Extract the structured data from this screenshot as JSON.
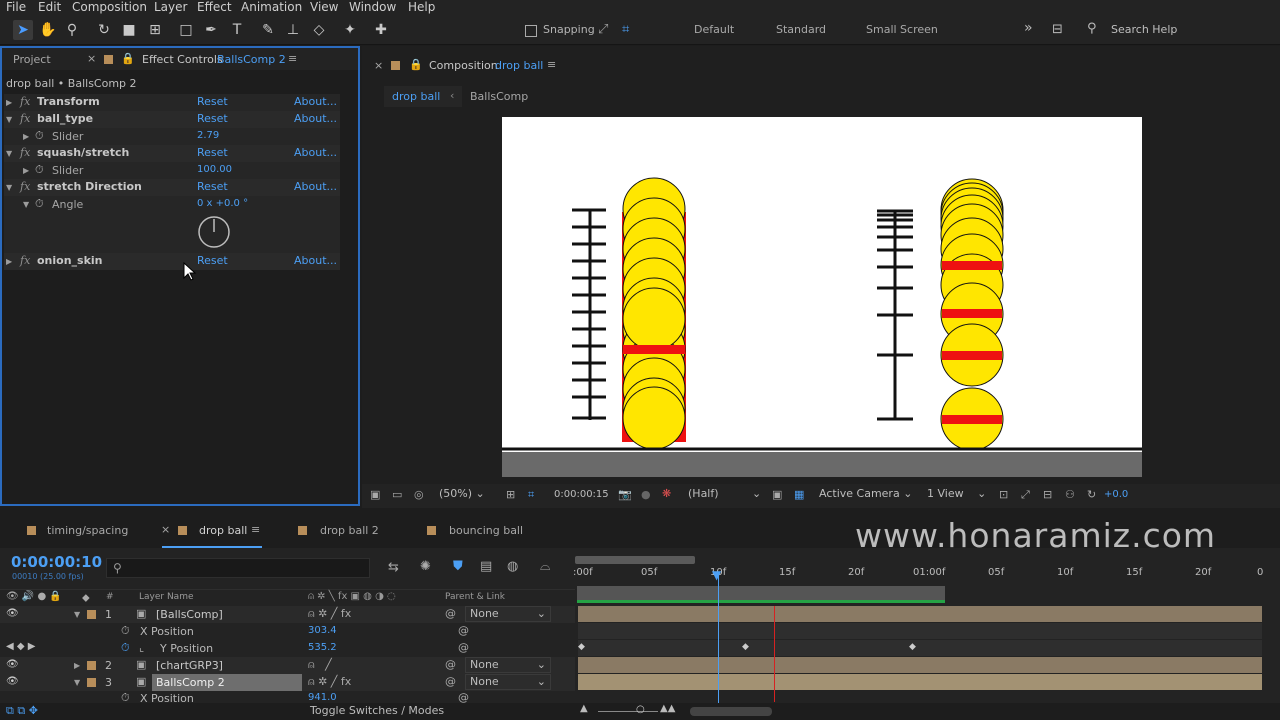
{
  "menu": [
    "File",
    "Edit",
    "Composition",
    "Layer",
    "Effect",
    "Animation",
    "View",
    "Window",
    "Help"
  ],
  "toolbar": {
    "snapping_label": "Snapping",
    "workspaces": [
      "Default",
      "Standard",
      "Small Screen"
    ],
    "search_placeholder": "Search Help"
  },
  "project_tab": "Project",
  "effect_controls": {
    "tab_label": "Effect Controls",
    "tab_target": "BallsComp 2",
    "breadcrumb": "drop ball • BallsComp 2",
    "reset_label": "Reset",
    "about_label": "About...",
    "effects": [
      {
        "name": "Transform"
      },
      {
        "name": "ball_type",
        "param": "Slider",
        "value": "2.79"
      },
      {
        "name": "squash/stretch",
        "param": "Slider",
        "value": "100.00"
      },
      {
        "name": "stretch Direction",
        "param": "Angle",
        "value": "0 x +0.0 °"
      },
      {
        "name": "onion_skin"
      }
    ]
  },
  "composition": {
    "tab_label": "Composition",
    "tab_target": "drop ball",
    "flow": [
      "drop ball",
      "BallsComp"
    ]
  },
  "viewer": {
    "zoom": "(50%)",
    "timecode": "0:00:00:15",
    "resolution": "(Half)",
    "camera": "Active Camera",
    "views": "1 View",
    "exposure": "+0.0"
  },
  "timeline": {
    "tabs": [
      "timing/spacing",
      "drop ball",
      "drop ball 2",
      "bouncing ball"
    ],
    "current_time": "0:00:00:10",
    "frame_info": "00010 (25.00 fps)",
    "col_layer_name": "Layer Name",
    "col_parent": "Parent & Link",
    "col_hash": "#",
    "ruler": [
      ":00f",
      "05f",
      "10f",
      "15f",
      "20f",
      "01:00f",
      "05f",
      "10f",
      "15f",
      "20f",
      "0"
    ],
    "rows": [
      {
        "num": "1",
        "name": "[BallsComp]",
        "parent": "None"
      },
      {
        "prop": "X Position",
        "value": "303.4"
      },
      {
        "prop": "Y Position",
        "value": "535.2"
      },
      {
        "num": "2",
        "name": "[chartGRP3]",
        "parent": "None"
      },
      {
        "num": "3",
        "name": "BallsComp 2",
        "parent": "None"
      },
      {
        "prop": "X Position",
        "value": "941.0"
      }
    ],
    "toggle_label": "Toggle Switches / Modes"
  },
  "watermark": "www.honaramiz.com"
}
